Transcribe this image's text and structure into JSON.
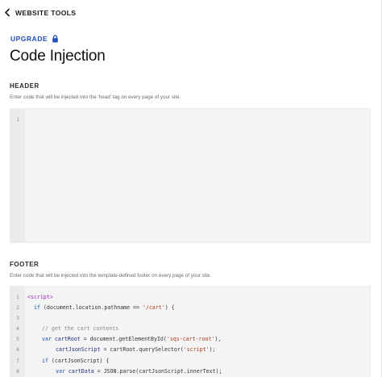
{
  "nav": {
    "back_label": "WEBSITE TOOLS"
  },
  "upgrade": {
    "label": "UPGRADE"
  },
  "page": {
    "title": "Code Injection"
  },
  "header_section": {
    "label": "HEADER",
    "description": "Enter code that will be injected into the 'head' tag on every page of your site.",
    "line_numbers": [
      "1"
    ]
  },
  "footer_section": {
    "label": "FOOTER",
    "description": "Enter code that will be injected into the template-defined footer on every page of your site.",
    "line_numbers": [
      "1",
      "2",
      "3",
      "4",
      "5",
      "6",
      "7",
      "8"
    ],
    "code": {
      "l1": "<script>",
      "l2_kw": "if",
      "l2_a": " (document.location.pathname == ",
      "l2_str": "'/cart'",
      "l2_b": ") {",
      "l4": "// get the cart contents",
      "l5_kw": "var",
      "l5_var": "cartRoot",
      "l5_a": " = document.getElementById(",
      "l5_str": "'sqs-cart-root'",
      "l5_b": "),",
      "l6_var": "cartJsonScript",
      "l6_a": " = cartRoot.querySelector(",
      "l6_str": "'script'",
      "l6_b": ");",
      "l7_kw": "if",
      "l7_a": " (cartJsonScript) {",
      "l8_kw": "var",
      "l8_var": "cartData",
      "l8_a": " = JSON.parse(cartJsonScript.innerText);"
    }
  },
  "colors": {
    "accent": "#1e4fc2",
    "editor_bg": "#f4f4f4",
    "gutter_bg": "#ebebeb"
  },
  "icons": {
    "back": "chevron-left-icon",
    "lock": "lock-icon"
  }
}
